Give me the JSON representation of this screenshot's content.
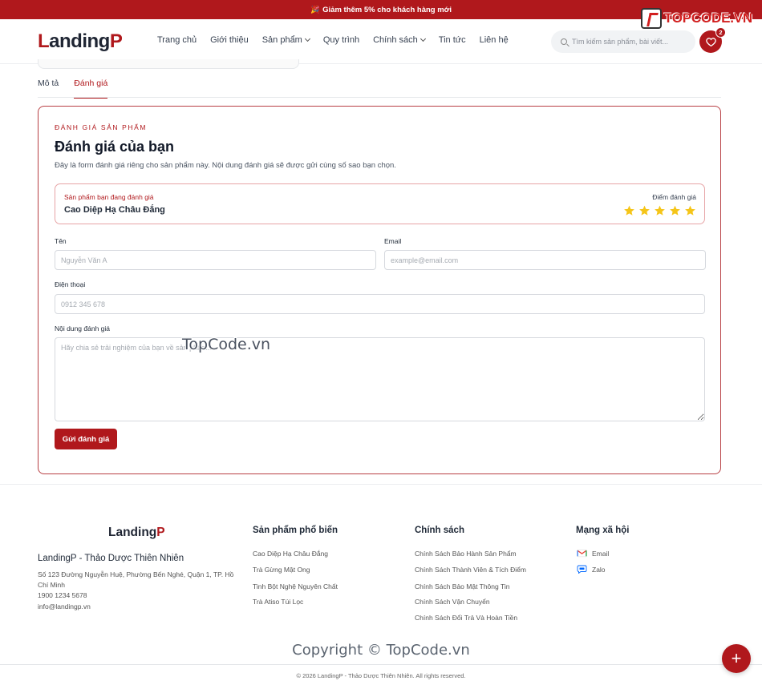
{
  "promo": {
    "icon": "party-popper-icon",
    "text": "Giảm thêm 5% cho khách hàng mới"
  },
  "watermark": {
    "logo_text": "TOPCODE.VN",
    "mid_text": "TopCode.vn",
    "copyright_text": "Copyright © TopCode.vn"
  },
  "header": {
    "logo": {
      "first": "L",
      "middle": "anding",
      "last": "P"
    },
    "nav": [
      {
        "label": "Trang chủ",
        "has_dropdown": false
      },
      {
        "label": "Giới thiệu",
        "has_dropdown": false
      },
      {
        "label": "Sản phẩm",
        "has_dropdown": true
      },
      {
        "label": "Quy trình",
        "has_dropdown": false
      },
      {
        "label": "Chính sách",
        "has_dropdown": true
      },
      {
        "label": "Tin tức",
        "has_dropdown": false
      },
      {
        "label": "Liên hệ",
        "has_dropdown": false
      }
    ],
    "search_placeholder": "Tìm kiếm sản phẩm, bài viết...",
    "wishlist_count": "2"
  },
  "tabs": [
    {
      "label": "Mô tả",
      "active": false
    },
    {
      "label": "Đánh giá",
      "active": true
    }
  ],
  "review": {
    "eyebrow": "ĐÁNH GIÁ SẢN PHẨM",
    "title": "Đánh giá của bạn",
    "description": "Đây là form đánh giá riêng cho sản phẩm này. Nội dung đánh giá sẽ được gửi cùng số sao bạn chọn.",
    "product_label": "Sản phẩm bạn đang đánh giá",
    "product_name": "Cao Diệp Hạ Châu Đắng",
    "score_label": "Điểm đánh giá",
    "rating": 5,
    "rating_max": 5,
    "star_color": "#f5c518",
    "fields": {
      "name_label": "Tên",
      "name_placeholder": "Nguyễn Văn A",
      "email_label": "Email",
      "email_placeholder": "example@email.com",
      "phone_label": "Điện thoại",
      "phone_placeholder": "0912 345 678",
      "content_label": "Nội dung đánh giá",
      "content_placeholder": "Hãy chia sẻ trải nghiệm của bạn về sản phẩm..."
    },
    "submit_label": "Gửi đánh giá"
  },
  "footer": {
    "logo": {
      "main": "Landing",
      "accent": "P"
    },
    "brand": "LandingP - Thảo Dược Thiên Nhiên",
    "address": "Số 123 Đường Nguyễn Huệ, Phường Bến Nghé, Quận 1, TP. Hồ Chí Minh",
    "phone": "1900 1234 5678",
    "email": "info@landingp.vn",
    "products_title": "Sản phẩm phổ biến",
    "products": [
      "Cao Diệp Hạ Châu Đắng",
      "Trà Gừng Mật Ong",
      "Tinh Bột Nghệ Nguyên Chất",
      "Trà Atiso Túi Lọc"
    ],
    "policy_title": "Chính sách",
    "policies": [
      "Chính Sách Bảo Hành Sản Phẩm",
      "Chính Sách Thành Viên & Tích Điểm",
      "Chính Sách Bảo Mật Thông Tin",
      "Chính Sách Vận Chuyển",
      "Chính Sách Đổi Trả Và Hoàn Tiền"
    ],
    "social_title": "Mạng xã hội",
    "socials": [
      {
        "icon": "gmail-icon",
        "label": "Email"
      },
      {
        "icon": "zalo-icon",
        "label": "Zalo"
      }
    ],
    "copyright": "© 2026 LandingP - Thảo Dược Thiên Nhiên. All rights reserved."
  },
  "fab": {
    "icon": "plus-icon",
    "symbol": "+"
  },
  "colors": {
    "brand": "#b0181c",
    "text": "#1f2937",
    "border": "#d6d9de"
  }
}
